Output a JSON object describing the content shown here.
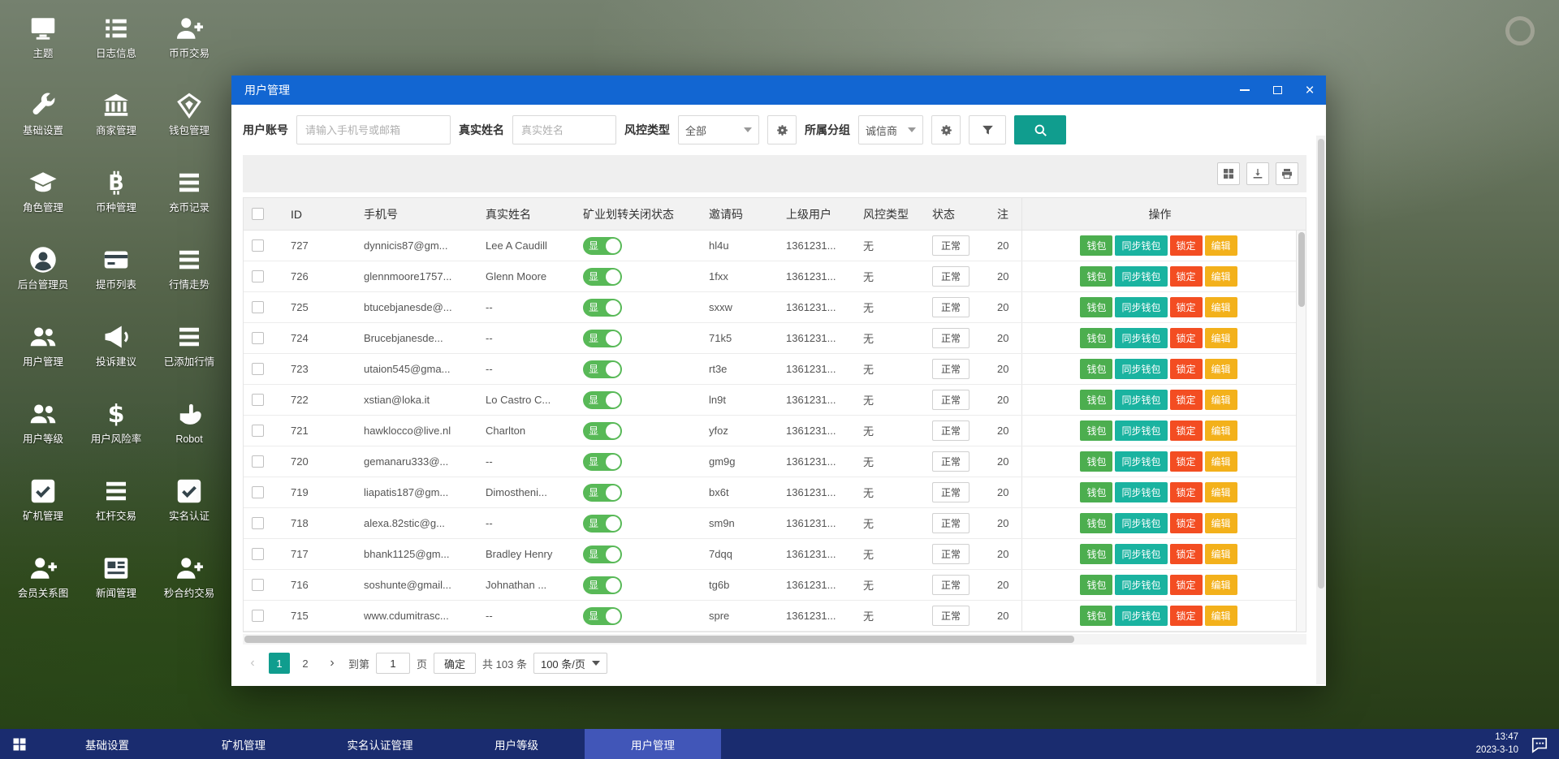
{
  "colors": {
    "titlebar": "#1266d2",
    "search_button": "#109d8e",
    "toggle_on": "#58b957",
    "wallet_button": "#4cae4f",
    "sync_button": "#1ab3a0",
    "lock_button": "#f34d22",
    "edit_button": "#f3b11b",
    "taskbar": "#1a2c6f",
    "taskbar_active": "#4156b8",
    "page_active": "#109d8e"
  },
  "desktop": {
    "shortcuts": [
      {
        "label": "主题",
        "icon": "monitor-icon"
      },
      {
        "label": "日志信息",
        "icon": "log-list-icon"
      },
      {
        "label": "币币交易",
        "icon": "user-add-icon"
      },
      {
        "label": "基础设置",
        "icon": "wrench-icon"
      },
      {
        "label": "商家管理",
        "icon": "bank-icon"
      },
      {
        "label": "钱包管理",
        "icon": "gem-icon"
      },
      {
        "label": "角色管理",
        "icon": "grad-cap-icon"
      },
      {
        "label": "币种管理",
        "icon": "bitcoin-icon"
      },
      {
        "label": "充币记录",
        "icon": "list-icon"
      },
      {
        "label": "后台管理员",
        "icon": "admin-user-icon"
      },
      {
        "label": "提币列表",
        "icon": "card-icon"
      },
      {
        "label": "行情走势",
        "icon": "list-icon"
      },
      {
        "label": "用户管理",
        "icon": "users-icon"
      },
      {
        "label": "投诉建议",
        "icon": "megaphone-icon"
      },
      {
        "label": "已添加行情",
        "icon": "list-icon"
      },
      {
        "label": "用户等级",
        "icon": "users-icon"
      },
      {
        "label": "用户风险率",
        "icon": "dollar-icon"
      },
      {
        "label": "Robot",
        "icon": "robot-hand-icon"
      },
      {
        "label": "矿机管理",
        "icon": "check-square-icon"
      },
      {
        "label": "杠杆交易",
        "icon": "list-icon"
      },
      {
        "label": "实名认证",
        "icon": "check-square-icon"
      },
      {
        "label": "会员关系图",
        "icon": "user-add-icon"
      },
      {
        "label": "新闻管理",
        "icon": "news-icon"
      },
      {
        "label": "秒合约交易",
        "icon": "user-add-icon"
      }
    ]
  },
  "window": {
    "title": "用户管理",
    "filters": {
      "account_label": "用户账号",
      "account_placeholder": "请输入手机号或邮箱",
      "realname_label": "真实姓名",
      "realname_placeholder": "真实姓名",
      "risk_label": "风控类型",
      "risk_value": "全部",
      "group_label": "所属分组",
      "group_value": "诚信商"
    },
    "table": {
      "columns": [
        "ID",
        "手机号",
        "真实姓名",
        "矿业划转关闭状态",
        "邀请码",
        "上级用户",
        "风控类型",
        "状态",
        "注",
        "操作"
      ],
      "toggle_on_label": "显",
      "action_labels": [
        "钱包",
        "同步钱包",
        "锁定",
        "编辑"
      ],
      "rows": [
        {
          "id": "727",
          "phone": "dynnicis87@gm...",
          "name": "Lee A Caudill",
          "invite": "hl4u",
          "parent": "1361231...",
          "risk": "无",
          "status": "正常",
          "reg": "20"
        },
        {
          "id": "726",
          "phone": "glennmoore1757...",
          "name": "Glenn Moore",
          "invite": "1fxx",
          "parent": "1361231...",
          "risk": "无",
          "status": "正常",
          "reg": "20"
        },
        {
          "id": "725",
          "phone": "btucebjanesde@...",
          "name": "--",
          "invite": "sxxw",
          "parent": "1361231...",
          "risk": "无",
          "status": "正常",
          "reg": "20"
        },
        {
          "id": "724",
          "phone": "Brucebjanesde...",
          "name": "--",
          "invite": "71k5",
          "parent": "1361231...",
          "risk": "无",
          "status": "正常",
          "reg": "20"
        },
        {
          "id": "723",
          "phone": "utaion545@gma...",
          "name": "--",
          "invite": "rt3e",
          "parent": "1361231...",
          "risk": "无",
          "status": "正常",
          "reg": "20"
        },
        {
          "id": "722",
          "phone": "xstian@loka.it",
          "name": "Lo Castro C...",
          "invite": "ln9t",
          "parent": "1361231...",
          "risk": "无",
          "status": "正常",
          "reg": "20"
        },
        {
          "id": "721",
          "phone": "hawklocco@live.nl",
          "name": "Charlton",
          "invite": "yfoz",
          "parent": "1361231...",
          "risk": "无",
          "status": "正常",
          "reg": "20"
        },
        {
          "id": "720",
          "phone": "gemanaru333@...",
          "name": "--",
          "invite": "gm9g",
          "parent": "1361231...",
          "risk": "无",
          "status": "正常",
          "reg": "20"
        },
        {
          "id": "719",
          "phone": "liapatis187@gm...",
          "name": "Dimostheni...",
          "invite": "bx6t",
          "parent": "1361231...",
          "risk": "无",
          "status": "正常",
          "reg": "20"
        },
        {
          "id": "718",
          "phone": "alexa.82stic@g...",
          "name": "--",
          "invite": "sm9n",
          "parent": "1361231...",
          "risk": "无",
          "status": "正常",
          "reg": "20"
        },
        {
          "id": "717",
          "phone": "bhank1125@gm...",
          "name": "Bradley Henry",
          "invite": "7dqq",
          "parent": "1361231...",
          "risk": "无",
          "status": "正常",
          "reg": "20"
        },
        {
          "id": "716",
          "phone": "soshunte@gmail...",
          "name": "Johnathan ...",
          "invite": "tg6b",
          "parent": "1361231...",
          "risk": "无",
          "status": "正常",
          "reg": "20"
        },
        {
          "id": "715",
          "phone": "www.cdumitrasc...",
          "name": "--",
          "invite": "spre",
          "parent": "1361231...",
          "risk": "无",
          "status": "正常",
          "reg": "20"
        }
      ]
    },
    "pagination": {
      "prev": "‹",
      "next": "›",
      "pages": [
        "1",
        "2"
      ],
      "active_page": "1",
      "goto_label": "到第",
      "goto_value": "1",
      "page_unit": "页",
      "confirm_label": "确定",
      "total_label": "共 103 条",
      "per_page_label": "100 条/页"
    }
  },
  "taskbar": {
    "items": [
      {
        "label": "基础设置",
        "active": false
      },
      {
        "label": "矿机管理",
        "active": false
      },
      {
        "label": "实名认证管理",
        "active": false
      },
      {
        "label": "用户等级",
        "active": false
      },
      {
        "label": "用户管理",
        "active": true
      }
    ],
    "time": "13:47",
    "date": "2023-3-10"
  }
}
